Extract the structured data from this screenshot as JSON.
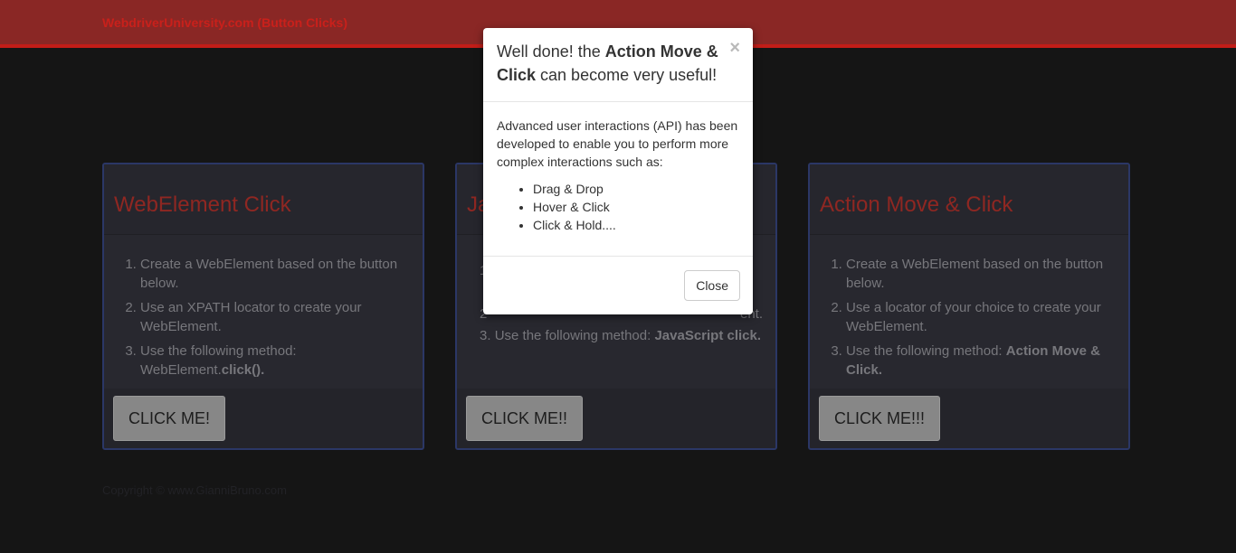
{
  "navbar": {
    "brand": "WebdriverUniversity.com (Button Clicks)"
  },
  "panels": [
    {
      "title": "WebElement Click",
      "steps": [
        {
          "text": "Create a WebElement based on the button below.",
          "bold": ""
        },
        {
          "text": "Use an XPATH locator to create your WebElement.",
          "bold": ""
        },
        {
          "text": "Use the following method: WebElement.",
          "bold": "click()."
        }
      ],
      "button": "CLICK ME!"
    },
    {
      "title_visible": "Ja",
      "steps": [
        {
          "text": "",
          "bold": ""
        },
        {
          "text": "ent.",
          "bold": ""
        },
        {
          "text": "Use the following method: ",
          "bold": "JavaScript click."
        }
      ],
      "button": "CLICK ME!!"
    },
    {
      "title": "Action Move & Click",
      "steps": [
        {
          "text": "Create a WebElement based on the button below.",
          "bold": ""
        },
        {
          "text": "Use a locator of your choice to create your WebElement.",
          "bold": ""
        },
        {
          "text": "Use the following method: ",
          "bold": "Action Move & Click."
        }
      ],
      "button": "CLICK ME!!!"
    }
  ],
  "footer": {
    "copyright": "Copyright © www.GianniBruno.com"
  },
  "modal": {
    "title_prefix": "Well done! the ",
    "title_bold": "Action Move & Click",
    "title_suffix": " can become very useful!",
    "close_symbol": "×",
    "body_text": "Advanced user interactions (API) has been developed to enable you to perform more complex interactions such as:",
    "list": [
      "Drag & Drop",
      "Hover & Click",
      "Click & Hold...."
    ],
    "close_button": "Close"
  },
  "colors": {
    "navbar": "#8a2725",
    "brand": "#c9201b",
    "panel_title": "#8f2722",
    "panel_border": "#2b3766"
  }
}
